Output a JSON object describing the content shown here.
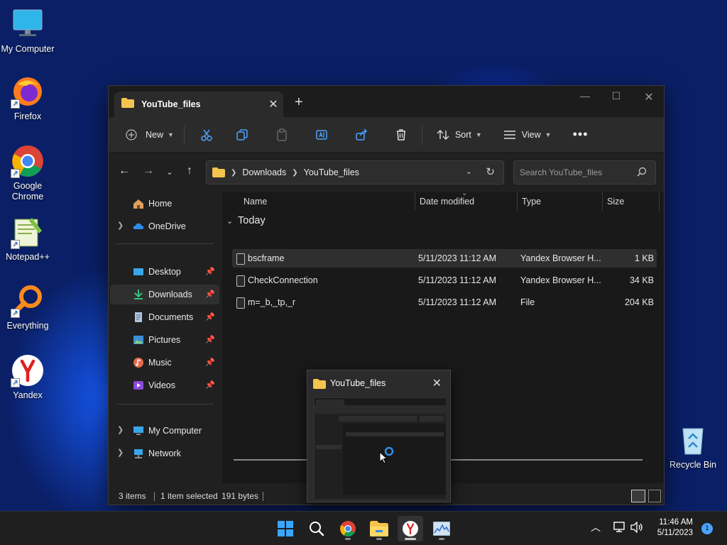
{
  "desktop": {
    "icons": [
      {
        "label": "My Computer"
      },
      {
        "label": "Firefox"
      },
      {
        "label": "Google Chrome"
      },
      {
        "label": "Notepad++"
      },
      {
        "label": "Everything"
      },
      {
        "label": "Yandex"
      },
      {
        "label": "Recycle Bin"
      }
    ]
  },
  "window": {
    "tab_title": "YouTube_files",
    "toolbar": {
      "new_label": "New",
      "sort_label": "Sort",
      "view_label": "View"
    },
    "address": {
      "crumbs": [
        "Downloads",
        "YouTube_files"
      ]
    },
    "search": {
      "placeholder": "Search YouTube_files"
    },
    "nav": {
      "items": [
        {
          "label": "Home"
        },
        {
          "label": "OneDrive"
        },
        {
          "label": "Desktop"
        },
        {
          "label": "Downloads"
        },
        {
          "label": "Documents"
        },
        {
          "label": "Pictures"
        },
        {
          "label": "Music"
        },
        {
          "label": "Videos"
        },
        {
          "label": "My Computer"
        },
        {
          "label": "Network"
        }
      ]
    },
    "columns": {
      "name": "Name",
      "date": "Date modified",
      "type": "Type",
      "size": "Size"
    },
    "group": "Today",
    "files": [
      {
        "name": "bscframe",
        "date": "5/11/2023 11:12 AM",
        "type": "Yandex Browser H...",
        "size": "1 KB"
      },
      {
        "name": "CheckConnection",
        "date": "5/11/2023 11:12 AM",
        "type": "Yandex Browser H...",
        "size": "34 KB"
      },
      {
        "name": "m=_b,_tp,_r",
        "date": "5/11/2023 11:12 AM",
        "type": "File",
        "size": "204 KB"
      }
    ],
    "status": {
      "items": "3 items",
      "selected": "1 item selected",
      "bytes": "191 bytes"
    }
  },
  "preview": {
    "title": "YouTube_files"
  },
  "taskbar": {
    "clock_time": "11:46 AM",
    "clock_date": "5/11/2023",
    "notifications": "1"
  },
  "colors": {
    "accent": "#4aa3ff",
    "folder": "#f5c44e",
    "window_bg": "#202020"
  }
}
